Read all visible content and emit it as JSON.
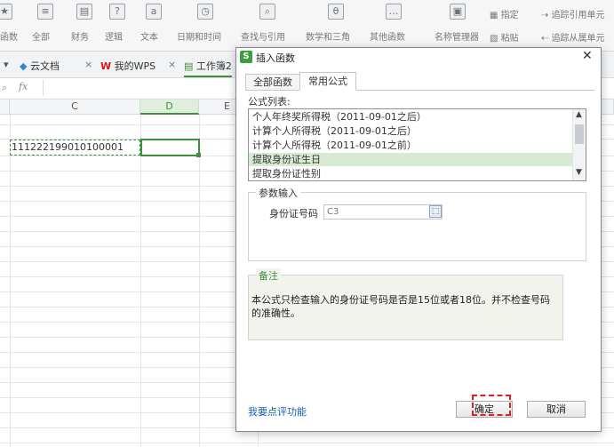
{
  "ribbon": {
    "left_labels": [
      "函数",
      "全部",
      "财务",
      "逻辑",
      "文本",
      "日期和时间",
      "查找与引用",
      "数学和三角",
      "其他函数",
      "名称管理器"
    ],
    "right_top": [
      "指定",
      "追踪引用单元"
    ],
    "right_bottom": [
      "粘贴",
      "追踪从属单元"
    ]
  },
  "tabs": {
    "tab1": "云文档",
    "tab2": "我的WPS",
    "tab3": "工作簿2"
  },
  "formula_bar": {
    "fx": "fx"
  },
  "grid": {
    "columns": [
      "C",
      "D",
      "E"
    ],
    "c3_value": "111222199010100001"
  },
  "dialog": {
    "title": "插入函数",
    "tabs": [
      "全部函数",
      "常用公式"
    ],
    "formula_list_label": "公式列表:",
    "formulas": [
      "个人年终奖所得税（2011-09-01之后）",
      "计算个人所得税（2011-09-01之后）",
      "计算个人所得税（2011-09-01之前）",
      "提取身份证生日",
      "提取身份证性别"
    ],
    "param_group": "参数输入",
    "param_label": "身份证号码",
    "param_value": "C3",
    "note_group": "备注",
    "note_text": "本公式只检查输入的身份证号码是否是15位或者18位。并不检查号码的准确性。",
    "feedback_link": "我要点评功能",
    "ok_label": "确定",
    "cancel_label": "取消"
  },
  "colors": {
    "accent": "#3e8f3e",
    "select_row": "#d9ead3",
    "link": "#1a5fb4"
  }
}
